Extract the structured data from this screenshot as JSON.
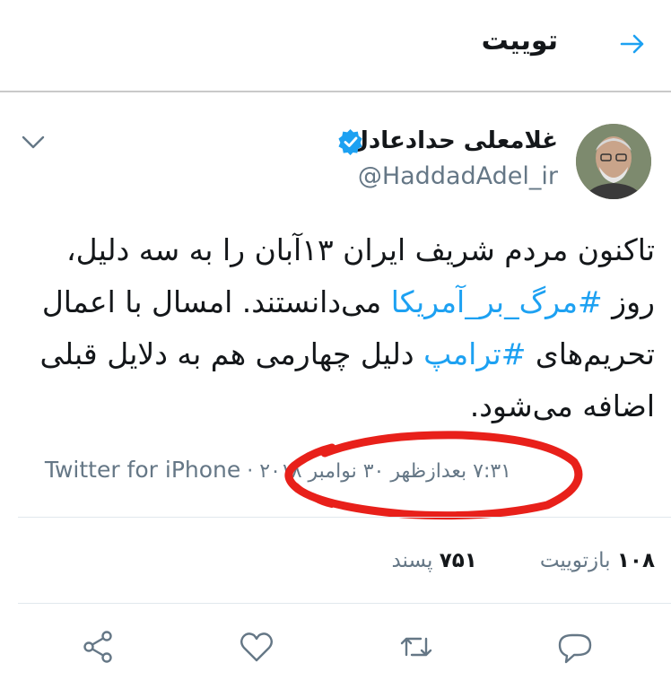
{
  "header": {
    "title": "توییت"
  },
  "tweet": {
    "author_name": "غلامعلی حدادعادل",
    "handle": "@HaddadAdel_ir",
    "text_parts": [
      "تاکنون مردم شریف ایران ۱۳آبان را به سه دلیل، روز ",
      "#مرگ_بر_آمریکا",
      " می‌دانستند. امسال با اعمال تحریم‌های ",
      "#ترامپ",
      " دلیل چهارمی هم به دلایل قبلی اضافه می‌شود."
    ],
    "timestamp": "۷:۳۱ بعدازظهر ۳۰ نوامبر ۲۰۱۸ ·",
    "source": "Twitter for iPhone"
  },
  "stats": {
    "retweets_count": "۱۰۸",
    "retweets_label": "بازتوییت",
    "likes_count": "۷۵۱",
    "likes_label": "پسند"
  },
  "colors": {
    "accent": "#1da1f2",
    "secondary_text": "#657786",
    "annotation": "#e8201a"
  }
}
